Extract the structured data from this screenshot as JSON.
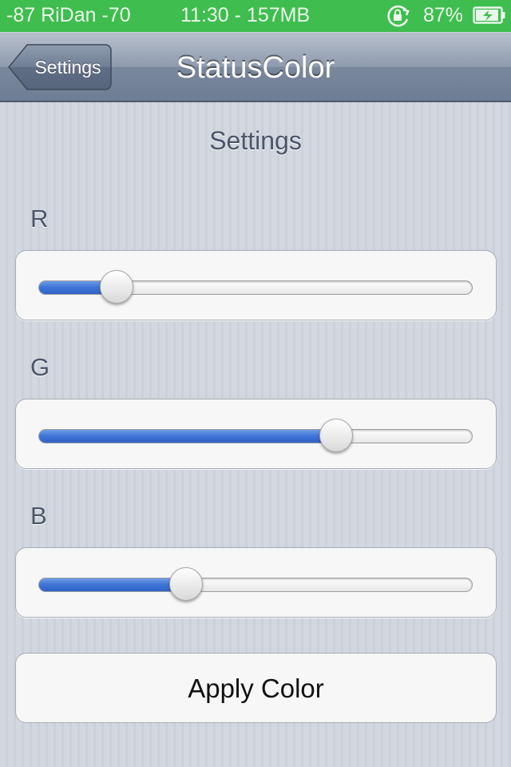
{
  "status_bar": {
    "signal_text": "-87 RiDan  -70",
    "time_text": "11:30 - 157MB",
    "battery_percent": "87%",
    "icons": [
      "rotation-lock-icon",
      "battery-charging-icon"
    ],
    "background_color": "#3fbd4f"
  },
  "nav": {
    "back_label": "Settings",
    "title": "StatusColor"
  },
  "content": {
    "section_title": "Settings",
    "sliders": [
      {
        "label": "R",
        "value": 0.18
      },
      {
        "label": "G",
        "value": 0.685
      },
      {
        "label": "B",
        "value": 0.34
      }
    ],
    "apply_label": "Apply Color"
  },
  "colors": {
    "slider_fill": "#3e74d6",
    "nav_bar": "#8e9bad"
  }
}
